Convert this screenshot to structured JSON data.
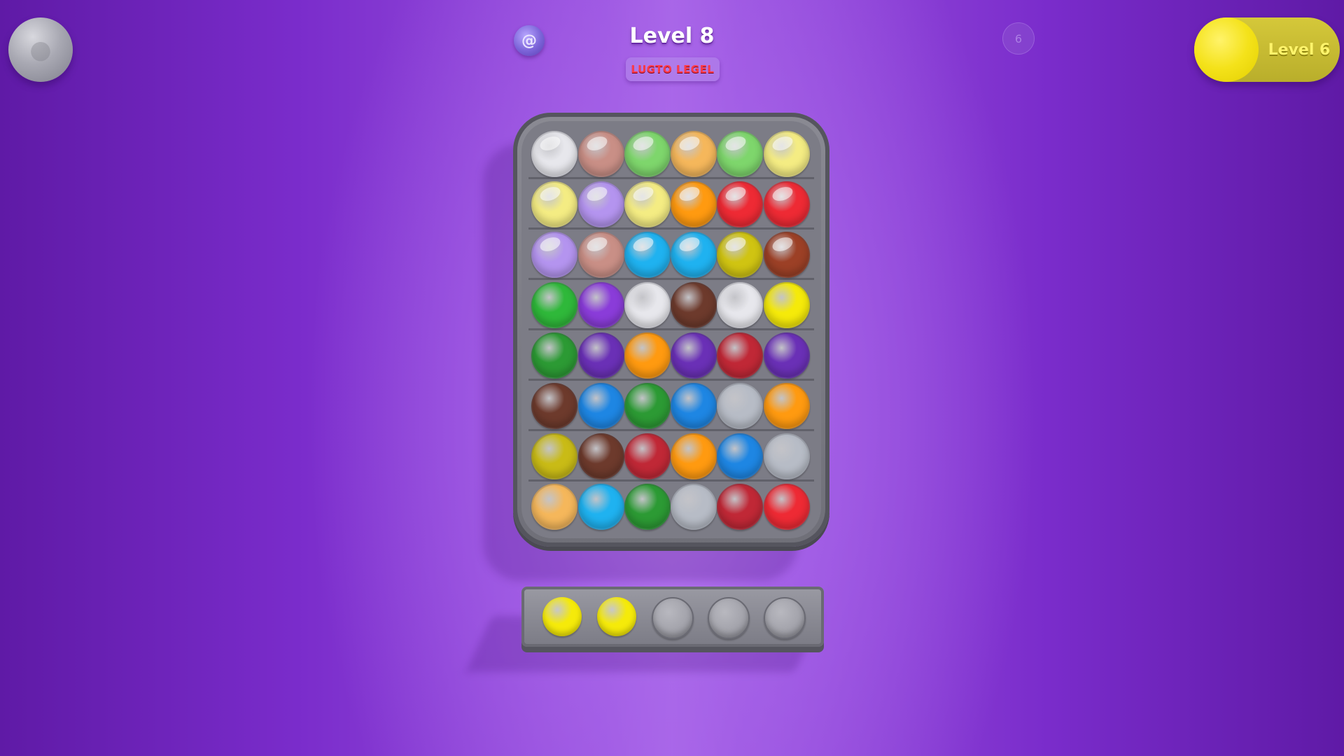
{
  "header": {
    "title": "Level 8",
    "badge": "LUGTO LEGEL",
    "left_icon": "swirl-icon",
    "right_icon": "lock-icon",
    "right_icon_text": "6"
  },
  "corner_button": {
    "icon": "round-button-icon"
  },
  "progress": {
    "label": "Level 6"
  },
  "colors": {
    "white": "#e7e7ec",
    "peach": "#c98f86",
    "lightgreen": "#7ed66c",
    "lightorange": "#f5b75b",
    "lightyellow": "#f4ec83",
    "lavender": "#b494ef",
    "orange": "#ff9a10",
    "red": "#ee2a34",
    "cyan": "#1fb2f0",
    "olive": "#d0c412",
    "rust": "#9c4026",
    "green": "#2fb83a",
    "purple": "#8a3cd9",
    "brown": "#6d3a2c",
    "yellow": "#f5ea0a",
    "darkgreen": "#2c9a34",
    "darkpurple": "#6a30b6",
    "darkred": "#c02836",
    "blue": "#1e86e3",
    "silver": "#b7bcc6",
    "mustard": "#c9bb16"
  },
  "board": {
    "rows": [
      [
        "white",
        "peach",
        "lightgreen",
        "lightorange",
        "lightgreen",
        "lightyellow"
      ],
      [
        "lightyellow",
        "lavender",
        "lightyellow",
        "orange",
        "red",
        "red"
      ],
      [
        "lavender",
        "peach",
        "cyan",
        "cyan",
        "olive",
        "rust"
      ],
      [
        "green",
        "purple",
        "white",
        "brown",
        "white",
        "yellow"
      ],
      [
        "darkgreen",
        "darkpurple",
        "orange",
        "darkpurple",
        "darkred",
        "darkpurple"
      ],
      [
        "brown",
        "blue",
        "darkgreen",
        "blue",
        "silver",
        "orange"
      ],
      [
        "mustard",
        "brown",
        "darkred",
        "orange",
        "blue",
        "silver"
      ],
      [
        "lightorange",
        "cyan",
        "darkgreen",
        "silver",
        "darkred",
        "red"
      ]
    ],
    "shiny_rows": 3
  },
  "tray": {
    "slots": [
      "yellow",
      "yellow",
      "empty",
      "empty",
      "empty"
    ]
  }
}
